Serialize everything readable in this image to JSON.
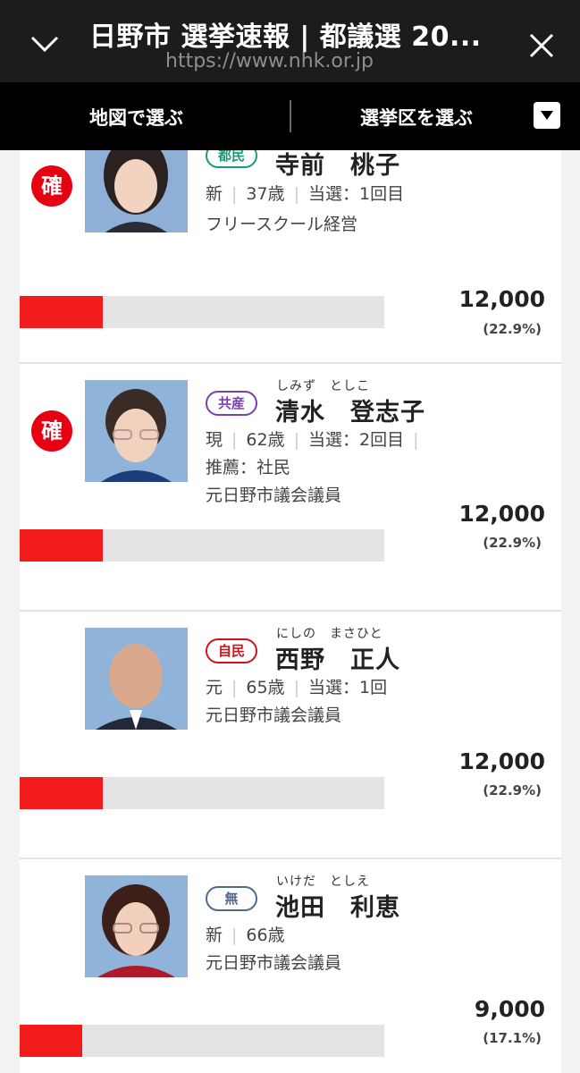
{
  "header": {
    "title": "日野市 選挙速報 | 都議選 20...",
    "url": "https://www.nhk.or.jp"
  },
  "subnav": {
    "map_label": "地図で選ぶ",
    "district_label": "選挙区を選ぶ"
  },
  "colors": {
    "elected": "#e60012",
    "bar": "#f21c1c"
  },
  "candidates": [
    {
      "elected_mark": "確",
      "party": "都民",
      "party_color": "#1a9b78",
      "kana": "",
      "name": "寺前　桃子",
      "status": "新",
      "age": "37歳",
      "wins": "当選：1回目",
      "line2": "フリースクール経営",
      "line3": "",
      "votes": "12,000",
      "percent": "(22.9%)",
      "share": 0.229
    },
    {
      "elected_mark": "確",
      "party": "共産",
      "party_color": "#7a3fb0",
      "kana": "しみず　としこ",
      "name": "清水　登志子",
      "status": "現",
      "age": "62歳",
      "wins": "当選：2回目",
      "line2": "推薦：社民",
      "line3": "元日野市議会議員",
      "votes": "12,000",
      "percent": "(22.9%)",
      "share": 0.229
    },
    {
      "elected_mark": "",
      "party": "自民",
      "party_color": "#c9161d",
      "kana": "にしの　まさひと",
      "name": "西野　正人",
      "status": "元",
      "age": "65歳",
      "wins": "当選：1回",
      "line2": "元日野市議会議員",
      "line3": "",
      "votes": "12,000",
      "percent": "(22.9%)",
      "share": 0.229
    },
    {
      "elected_mark": "",
      "party": "無",
      "party_color": "#4f6b8a",
      "kana": "いけだ　としえ",
      "name": "池田　利恵",
      "status": "新",
      "age": "66歳",
      "wins": "",
      "line2": "元日野市議会議員",
      "line3": "",
      "votes": "9,000",
      "percent": "(17.1%)",
      "share": 0.171
    }
  ]
}
